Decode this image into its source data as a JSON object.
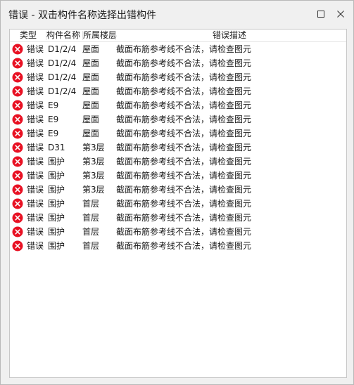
{
  "window": {
    "title": "错误 - 双击构件名称选择出错构件"
  },
  "icons": {
    "maximize": "maximize-icon",
    "close": "close-icon",
    "error": "error-icon",
    "error_color": "#e81123"
  },
  "columns": {
    "type": "类型",
    "name": "构件名称",
    "floor": "所属楼层",
    "description": "错误描述"
  },
  "rows": [
    {
      "type": "错误",
      "name": "D1/2/4",
      "floor": "屋面",
      "description": "截面布筋参考线不合法，请检查图元"
    },
    {
      "type": "错误",
      "name": "D1/2/4",
      "floor": "屋面",
      "description": "截面布筋参考线不合法，请检查图元"
    },
    {
      "type": "错误",
      "name": "D1/2/4",
      "floor": "屋面",
      "description": "截面布筋参考线不合法，请检查图元"
    },
    {
      "type": "错误",
      "name": "D1/2/4",
      "floor": "屋面",
      "description": "截面布筋参考线不合法，请检查图元"
    },
    {
      "type": "错误",
      "name": "E9",
      "floor": "屋面",
      "description": "截面布筋参考线不合法，请检查图元"
    },
    {
      "type": "错误",
      "name": "E9",
      "floor": "屋面",
      "description": "截面布筋参考线不合法，请检查图元"
    },
    {
      "type": "错误",
      "name": "E9",
      "floor": "屋面",
      "description": "截面布筋参考线不合法，请检查图元"
    },
    {
      "type": "错误",
      "name": "D31",
      "floor": "第3层",
      "description": "截面布筋参考线不合法，请检查图元"
    },
    {
      "type": "错误",
      "name": "围护",
      "floor": "第3层",
      "description": "截面布筋参考线不合法，请检查图元"
    },
    {
      "type": "错误",
      "name": "围护",
      "floor": "第3层",
      "description": "截面布筋参考线不合法，请检查图元"
    },
    {
      "type": "错误",
      "name": "围护",
      "floor": "第3层",
      "description": "截面布筋参考线不合法，请检查图元"
    },
    {
      "type": "错误",
      "name": "围护",
      "floor": "首层",
      "description": "截面布筋参考线不合法，请检查图元"
    },
    {
      "type": "错误",
      "name": "围护",
      "floor": "首层",
      "description": "截面布筋参考线不合法，请检查图元"
    },
    {
      "type": "错误",
      "name": "围护",
      "floor": "首层",
      "description": "截面布筋参考线不合法，请检查图元"
    },
    {
      "type": "错误",
      "name": "围护",
      "floor": "首层",
      "description": "截面布筋参考线不合法，请检查图元"
    }
  ]
}
